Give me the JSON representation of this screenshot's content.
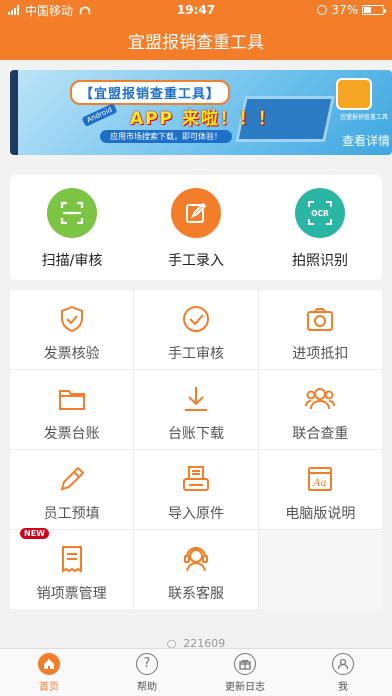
{
  "status_bar": {
    "carrier": "中国移动",
    "time": "19:47",
    "battery": "37%",
    "battery_level": 0.37
  },
  "nav": {
    "title": "宜盟报销查重工具"
  },
  "banner": {
    "headline": "【宜盟报销查重工具】",
    "platform": "Android",
    "slogan": "APP 来啦！！！",
    "subtext": "应用市场搜索下载，即可体验！",
    "app_caption": "宜盟报销查重工具",
    "more_link": "查看详情"
  },
  "quick_actions": [
    {
      "label": "扫描/审核",
      "icon": "scan-icon",
      "color": "#7cc544"
    },
    {
      "label": "手工录入",
      "icon": "edit-icon",
      "color": "#f47d2a"
    },
    {
      "label": "拍照识别",
      "icon": "ocr-icon",
      "color": "#2bb5a5"
    }
  ],
  "grid": [
    {
      "label": "发票核验",
      "icon": "shield-check-icon"
    },
    {
      "label": "手工审核",
      "icon": "check-circle-icon"
    },
    {
      "label": "进项抵扣",
      "icon": "camera-icon"
    },
    {
      "label": "发票台账",
      "icon": "folder-icon"
    },
    {
      "label": "台账下载",
      "icon": "download-icon"
    },
    {
      "label": "联合查重",
      "icon": "users-icon"
    },
    {
      "label": "员工预填",
      "icon": "pencil-icon"
    },
    {
      "label": "导入原件",
      "icon": "printer-icon"
    },
    {
      "label": "电脑版说明",
      "icon": "font-doc-icon"
    },
    {
      "label": "销项票管理",
      "icon": "receipt-icon",
      "badge": "NEW"
    },
    {
      "label": "联系客服",
      "icon": "headset-icon"
    }
  ],
  "version": "221609",
  "tabbar": [
    {
      "label": "首页",
      "icon": "home-icon",
      "active": true
    },
    {
      "label": "帮助",
      "icon": "help-icon"
    },
    {
      "label": "更新日志",
      "icon": "gift-icon"
    },
    {
      "label": "我",
      "icon": "user-icon"
    }
  ],
  "colors": {
    "accent": "#f47d2a"
  }
}
